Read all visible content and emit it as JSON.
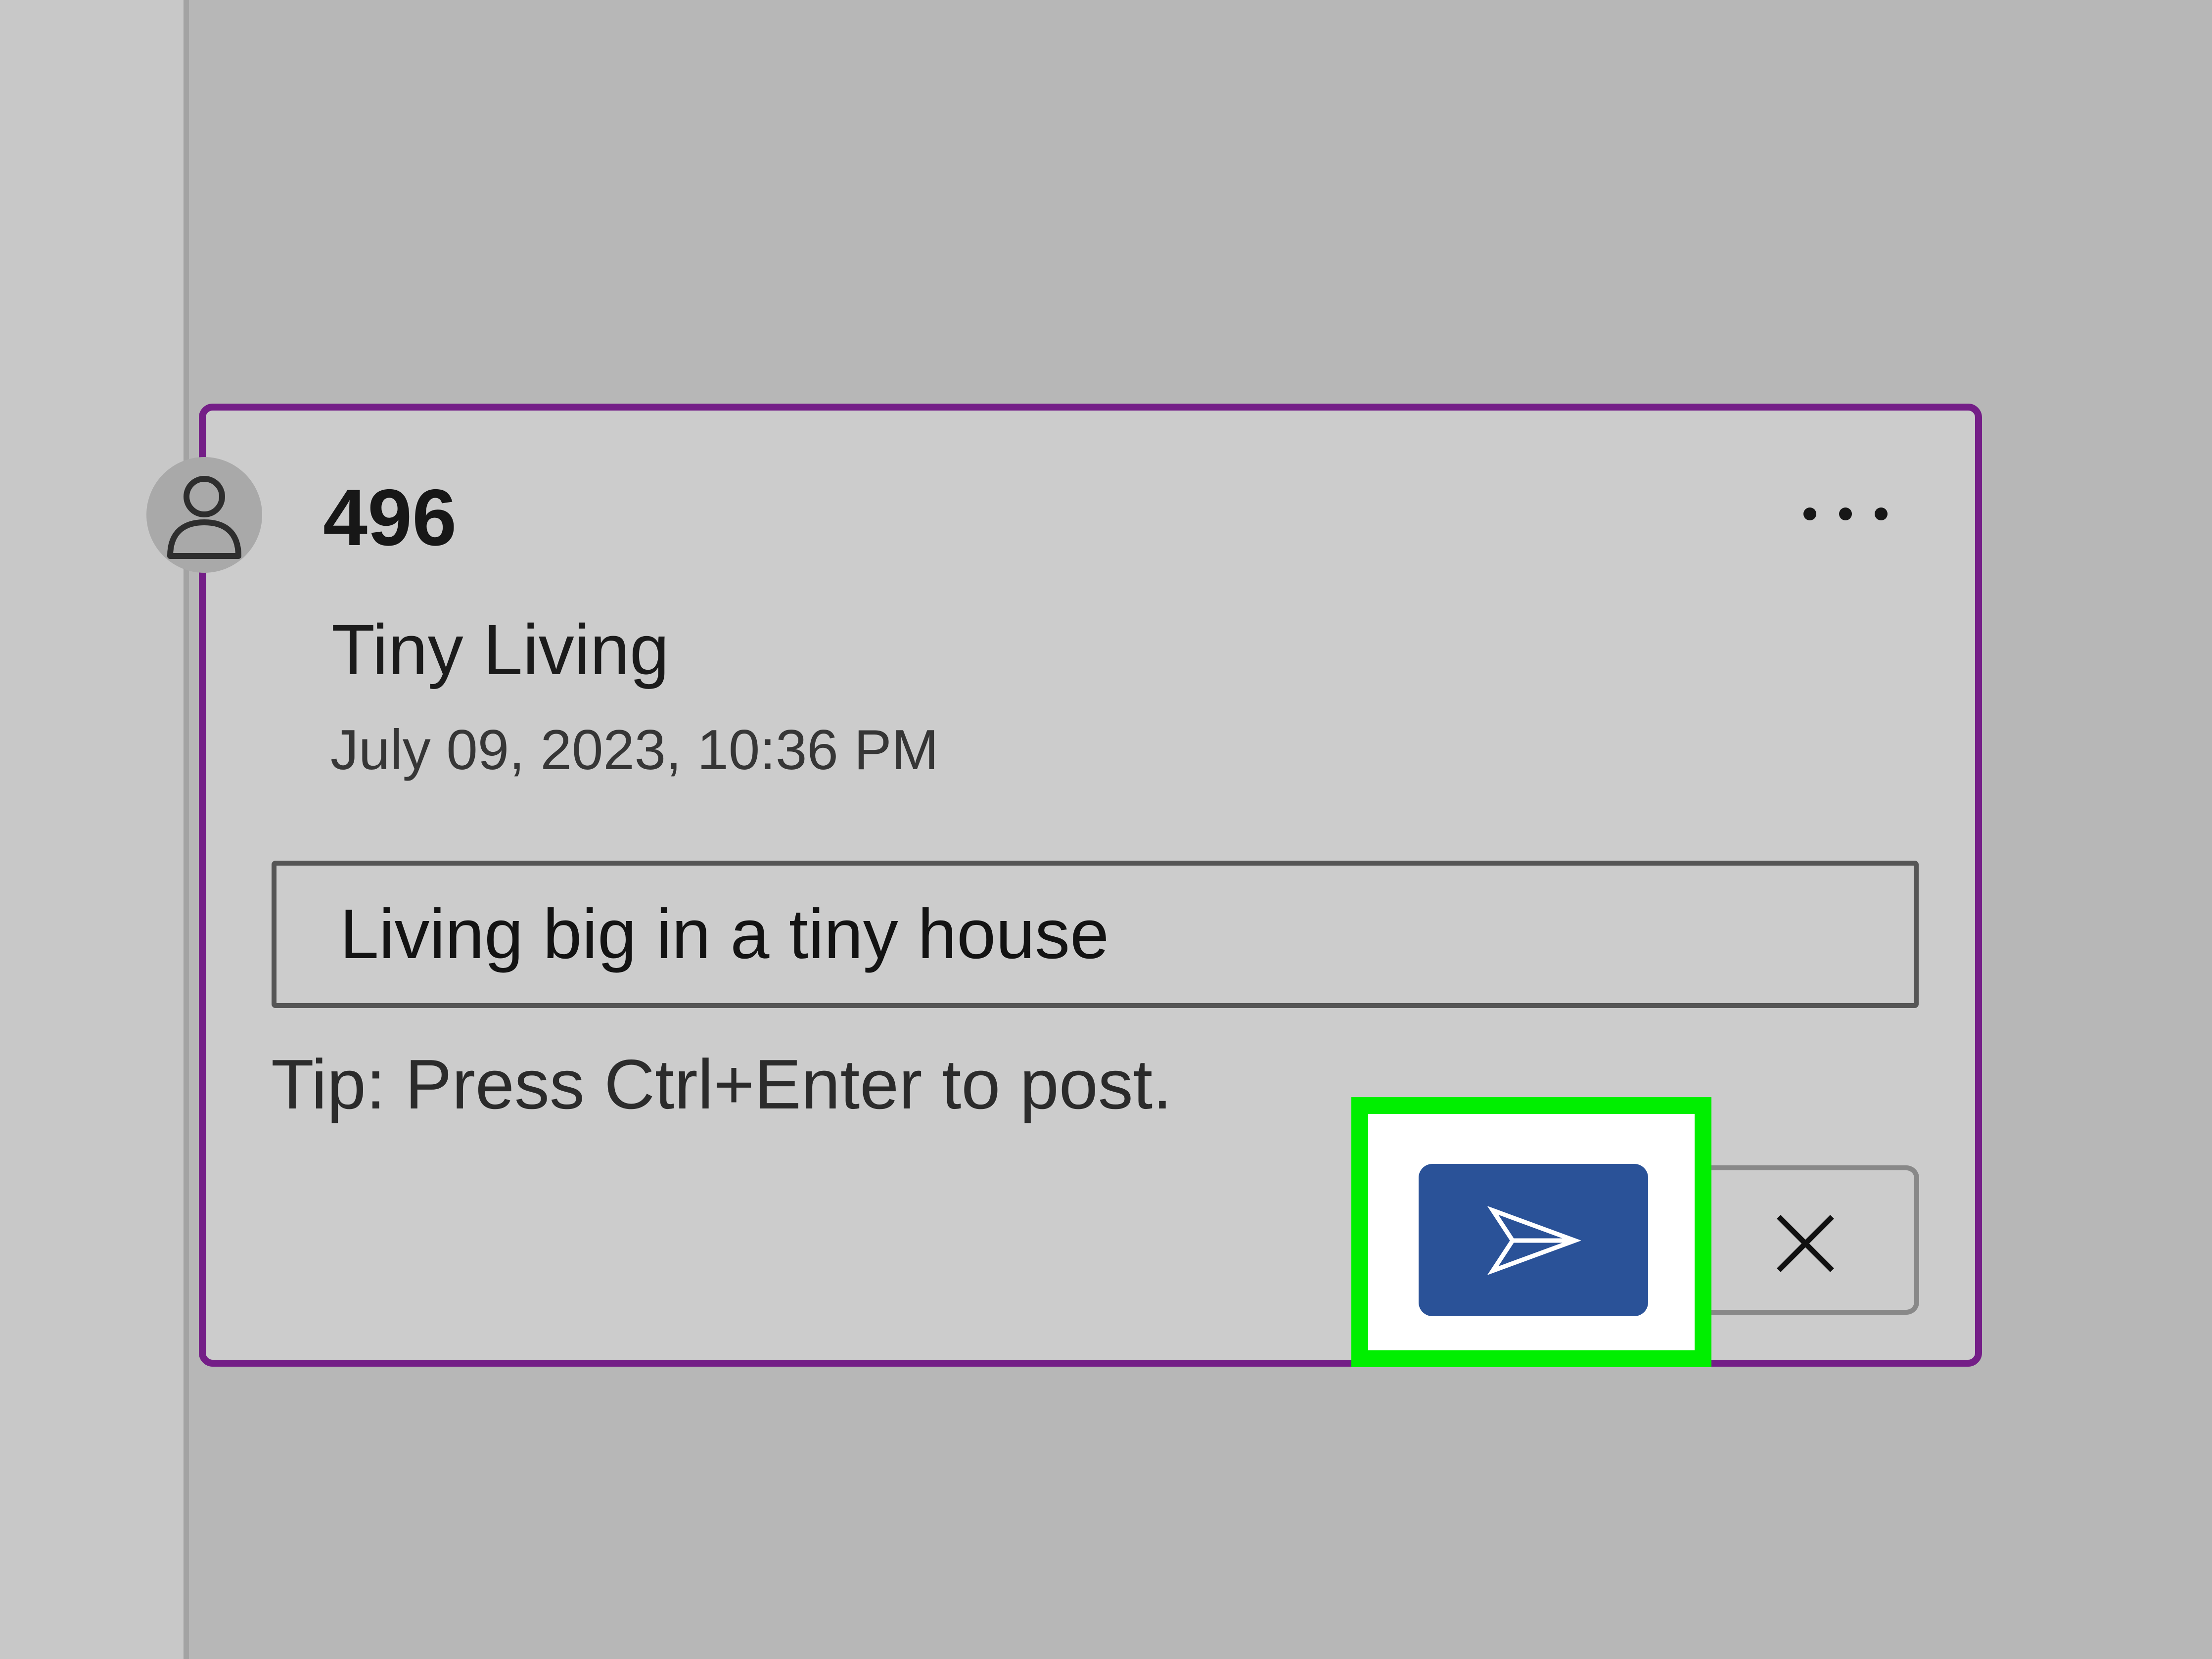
{
  "comment": {
    "author": "496",
    "topic": "Tiny Living",
    "timestamp": "July 09, 2023, 10:36 PM",
    "reply_value": "Living big in a tiny house",
    "tip": "Tip: Press Ctrl+Enter to post."
  },
  "icons": {
    "avatar": "person-icon",
    "more": "more-options-icon",
    "send": "send-icon",
    "cancel": "close-icon"
  },
  "colors": {
    "card_border": "#741e87",
    "send_button": "#2a5298",
    "highlight": "#00ef00"
  }
}
